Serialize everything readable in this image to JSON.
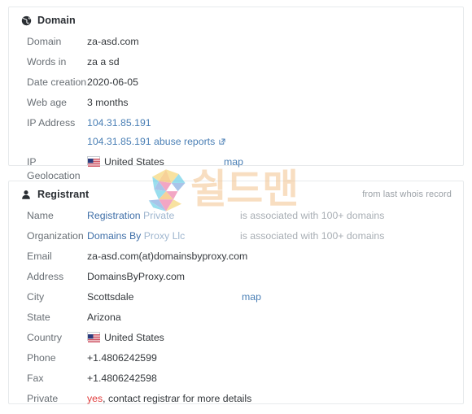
{
  "watermark": {
    "logo_letter": "S",
    "text": "쉴드맨",
    "text_color": "#f3c08a"
  },
  "domain_card": {
    "title": "Domain",
    "icon": "globe-icon",
    "rows": [
      {
        "label": "Domain",
        "value": "za-asd.com"
      },
      {
        "label": "Words in",
        "value": "za a sd"
      },
      {
        "label": "Date creation",
        "value": "2020-06-05"
      },
      {
        "label": "Web age",
        "value": "3 months"
      }
    ],
    "ip_label": "IP Address",
    "ip_value": "104.31.85.191",
    "ip_abuse_value": "104.31.85.191 abuse reports",
    "ip_abuse_icon": "external-link-icon",
    "geo_label": "IP Geolocation",
    "geo_value": "United States",
    "geo_flag": "us-flag-icon",
    "geo_map_label": "map"
  },
  "registrant_card": {
    "title": "Registrant",
    "icon": "user-icon",
    "note": "from last whois record",
    "name_label": "Name",
    "name_link": "Registration",
    "name_muted": "Private",
    "name_assoc": "is associated with 100+ domains",
    "org_label": "Organization",
    "org_link": "Domains By",
    "org_muted": "Proxy Llc",
    "org_assoc": "is associated with 100+ domains",
    "rows": [
      {
        "label": "Email",
        "value": "za-asd.com(at)domainsbyproxy.com"
      },
      {
        "label": "Address",
        "value": "DomainsByProxy.com"
      }
    ],
    "city_label": "City",
    "city_value": "Scottsdale",
    "city_map_label": "map",
    "state_label": "State",
    "state_value": "Arizona",
    "country_label": "Country",
    "country_value": "United States",
    "country_flag": "us-flag-icon",
    "phone_label": "Phone",
    "phone_value": "+1.4806242599",
    "fax_label": "Fax",
    "fax_value": "+1.4806242598",
    "private_label": "Private",
    "private_yes": "yes",
    "private_rest": ", contact registrar for more details",
    "private_yes_color": "#e03b3b"
  }
}
